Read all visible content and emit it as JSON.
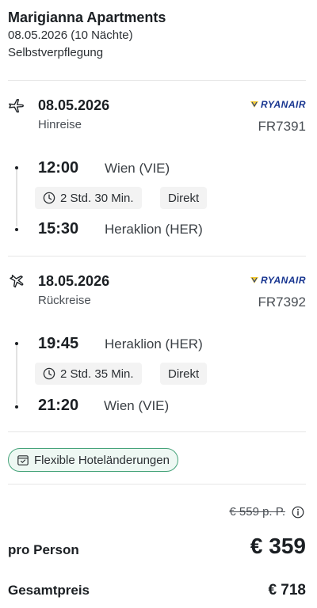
{
  "hotel": {
    "name": "Marigianna Apartments",
    "dates": "08.05.2026 (10 Nächte)",
    "board": "Selbstverpflegung"
  },
  "outbound": {
    "date": "08.05.2026",
    "direction": "Hinreise",
    "airline": "RYANAIR",
    "flight_number": "FR7391",
    "departure_time": "12:00",
    "departure_place": "Wien (VIE)",
    "duration": "2 Std. 30 Min.",
    "stops": "Direkt",
    "arrival_time": "15:30",
    "arrival_place": "Heraklion (HER)"
  },
  "return": {
    "date": "18.05.2026",
    "direction": "Rückreise",
    "airline": "RYANAIR",
    "flight_number": "FR7392",
    "departure_time": "19:45",
    "departure_place": "Heraklion (HER)",
    "duration": "2 Std. 35 Min.",
    "stops": "Direkt",
    "arrival_time": "21:20",
    "arrival_place": "Wien (VIE)"
  },
  "badge": {
    "label": "Flexible Hoteländerungen"
  },
  "pricing": {
    "old_price": "€ 559 p. P.",
    "per_person_label": "pro Person",
    "per_person_price": "€ 359",
    "total_label": "Gesamtpreis",
    "total_price": "€ 718"
  },
  "colors": {
    "airline_blue": "#173590",
    "airline_yellow": "#f1c933",
    "badge_green": "#46a37a"
  },
  "icons": {
    "outbound": "plane-departure-icon",
    "return": "plane-arrival-icon",
    "duration": "clock-icon",
    "badge": "calendar-check-icon",
    "price_info": "info-icon"
  }
}
